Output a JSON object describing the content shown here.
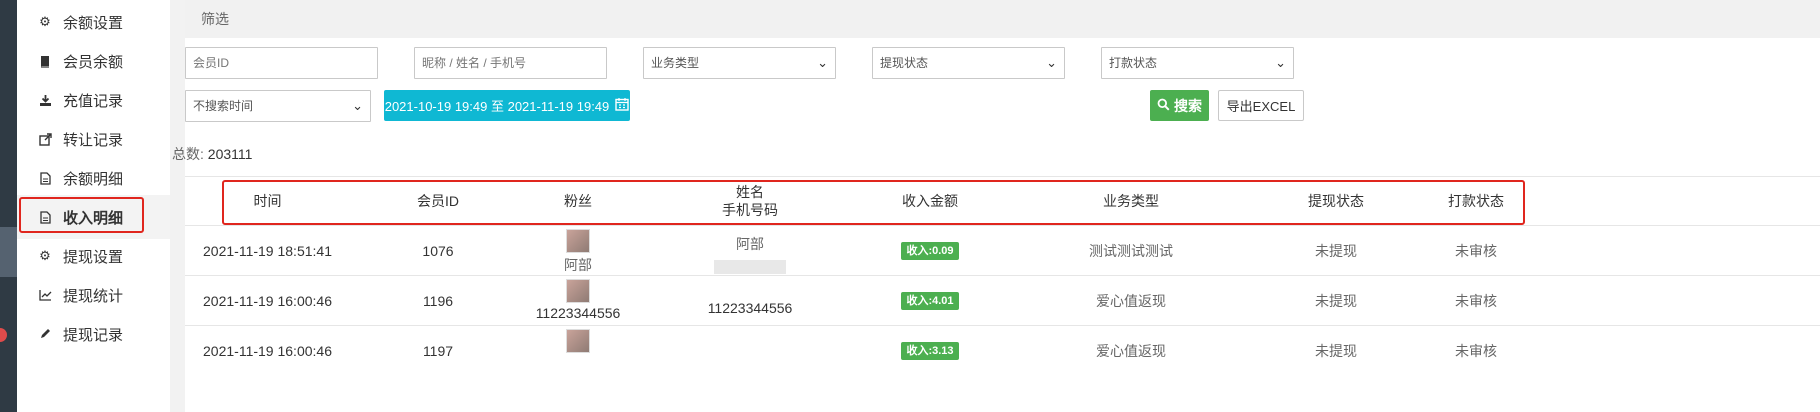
{
  "sidebar": {
    "items": [
      {
        "label": "余额设置",
        "icon": "gear-icon"
      },
      {
        "label": "会员余额",
        "icon": "book-icon"
      },
      {
        "label": "充值记录",
        "icon": "download-icon"
      },
      {
        "label": "转让记录",
        "icon": "share-icon"
      },
      {
        "label": "余额明细",
        "icon": "document-icon"
      },
      {
        "label": "收入明细",
        "icon": "document-icon",
        "active": true
      },
      {
        "label": "提现设置",
        "icon": "gear-icon"
      },
      {
        "label": "提现统计",
        "icon": "line-chart-icon"
      },
      {
        "label": "提现记录",
        "icon": "pencil-icon"
      }
    ]
  },
  "filter": {
    "header": "筛选",
    "member_id_placeholder": "会员ID",
    "name_placeholder": "昵称 / 姓名 / 手机号",
    "business_type": "业务类型",
    "withdraw_status": "提现状态",
    "payment_status": "打款状态",
    "time_mode": "不搜索时间",
    "date_range": "2021-10-19 19:49 至 2021-11-19 19:49",
    "search_label": "搜索",
    "export_label": "导出EXCEL"
  },
  "summary": {
    "total_label": "总数:",
    "total_value": "203111"
  },
  "table": {
    "headers": {
      "time": "时间",
      "member_id": "会员ID",
      "fans": "粉丝",
      "name": "姓名",
      "phone": "手机号码",
      "income": "收入金额",
      "business_type": "业务类型",
      "withdraw_status": "提现状态",
      "payment_status": "打款状态"
    },
    "rows": [
      {
        "time": "2021-11-19 18:51:41",
        "member_id": "1076",
        "fan_name": "阿部",
        "name": "阿部",
        "phone": "",
        "income": "收入:0.09",
        "business_type": "测试测试测试",
        "withdraw_status": "未提现",
        "payment_status": "未审核"
      },
      {
        "time": "2021-11-19 16:00:46",
        "member_id": "1196",
        "fan_name": "11223344556",
        "name": "",
        "phone": "11223344556",
        "income": "收入:4.01",
        "business_type": "爱心值返现",
        "withdraw_status": "未提现",
        "payment_status": "未审核"
      },
      {
        "time": "2021-11-19 16:00:46",
        "member_id": "1197",
        "fan_name": "",
        "name": "",
        "phone": "",
        "income": "收入:3.13",
        "business_type": "爱心值返现",
        "withdraw_status": "未提现",
        "payment_status": "未审核"
      }
    ]
  },
  "colors": {
    "accent": "#0fb8d3",
    "success": "#4caf50",
    "highlight": "#e0261e"
  }
}
